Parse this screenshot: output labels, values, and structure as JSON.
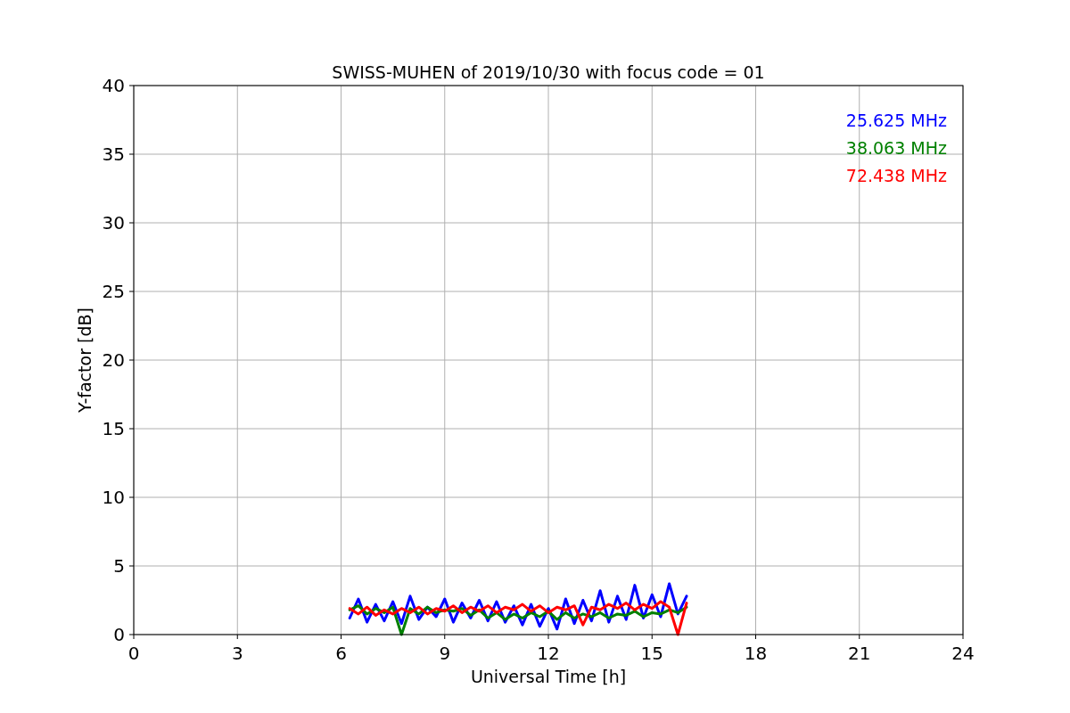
{
  "chart_data": {
    "type": "line",
    "title": "SWISS-MUHEN of 2019/10/30 with focus code = 01",
    "xlabel": "Universal Time [h]",
    "ylabel": "Y-factor [dB]",
    "x": [
      6.25,
      6.5,
      6.75,
      7,
      7.25,
      7.5,
      7.75,
      8,
      8.25,
      8.5,
      8.75,
      9,
      9.25,
      9.5,
      9.75,
      10,
      10.25,
      10.5,
      10.75,
      11,
      11.25,
      11.5,
      11.75,
      12,
      12.25,
      12.5,
      12.75,
      13,
      13.25,
      13.5,
      13.75,
      14,
      14.25,
      14.5,
      14.75,
      15,
      15.25,
      15.5,
      15.75,
      16
    ],
    "series": [
      {
        "name": "25.625 MHz",
        "color": "#0000ff",
        "values": [
          1.2,
          2.6,
          0.9,
          2.2,
          1.0,
          2.4,
          0.8,
          2.8,
          1.1,
          2.0,
          1.3,
          2.6,
          0.9,
          2.3,
          1.2,
          2.5,
          1.0,
          2.4,
          0.9,
          2.1,
          0.7,
          2.2,
          0.6,
          1.9,
          0.4,
          2.6,
          0.8,
          2.5,
          1.0,
          3.2,
          0.9,
          2.8,
          1.1,
          3.6,
          1.2,
          2.9,
          1.3,
          3.7,
          1.5,
          2.8
        ]
      },
      {
        "name": "38.063 MHz",
        "color": "#008000",
        "values": [
          1.8,
          2.1,
          1.5,
          1.9,
          1.6,
          2.0,
          0.0,
          1.9,
          1.5,
          2.0,
          1.6,
          1.8,
          1.7,
          1.9,
          1.4,
          1.8,
          1.2,
          1.6,
          1.1,
          1.5,
          1.2,
          1.6,
          1.3,
          1.7,
          1.1,
          1.6,
          1.2,
          1.5,
          1.3,
          1.6,
          1.2,
          1.5,
          1.4,
          1.7,
          1.3,
          1.6,
          1.5,
          1.8,
          1.6,
          2.0
        ]
      },
      {
        "name": "72.438 MHz",
        "color": "#ff0000",
        "values": [
          1.9,
          1.5,
          2.0,
          1.4,
          1.8,
          1.5,
          1.9,
          1.6,
          2.0,
          1.5,
          1.9,
          1.7,
          2.1,
          1.6,
          2.0,
          1.7,
          2.1,
          1.6,
          2.0,
          1.8,
          2.2,
          1.7,
          2.1,
          1.6,
          2.0,
          1.8,
          2.1,
          0.7,
          2.0,
          1.8,
          2.2,
          1.9,
          2.3,
          1.8,
          2.2,
          1.9,
          2.4,
          2.0,
          0.0,
          2.3
        ]
      }
    ],
    "grid": true,
    "xlim": [
      0,
      24
    ],
    "ylim": [
      0,
      40
    ],
    "xticks": [
      0,
      3,
      6,
      9,
      12,
      15,
      18,
      21,
      24
    ],
    "yticks": [
      0,
      5,
      10,
      15,
      20,
      25,
      30,
      35,
      40
    ]
  }
}
